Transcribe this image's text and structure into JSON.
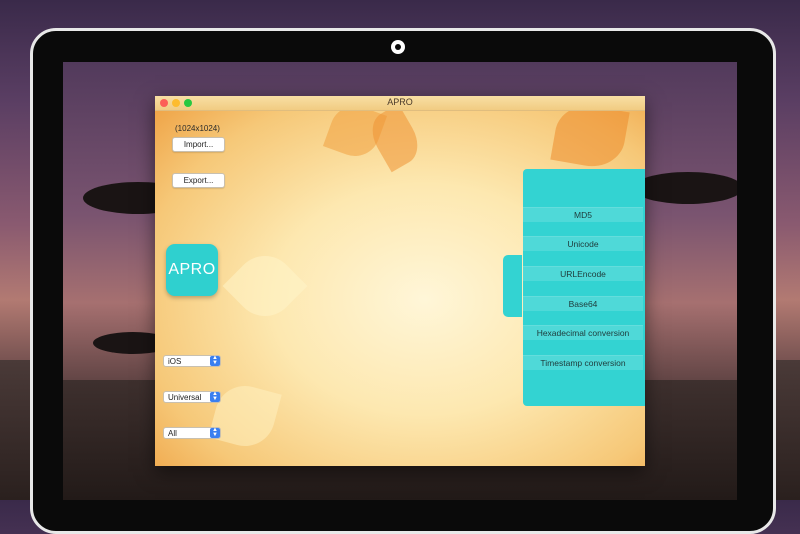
{
  "app": {
    "title": "APRO"
  },
  "image_import": {
    "size_hint": "(1024x1024)",
    "import_label": "Import...",
    "export_label": "Export..."
  },
  "app_icon": {
    "text": "APRO",
    "color": "#2fd0cf"
  },
  "selectors": {
    "platform": "iOS",
    "device": "Universal",
    "filter": "All"
  },
  "panel": {
    "color": "#33d3d2",
    "items": [
      {
        "label": "MD5"
      },
      {
        "label": "Unicode"
      },
      {
        "label": "URLEncode"
      },
      {
        "label": "Base64"
      },
      {
        "label": "Hexadecimal conversion"
      },
      {
        "label": "Timestamp conversion"
      }
    ]
  }
}
